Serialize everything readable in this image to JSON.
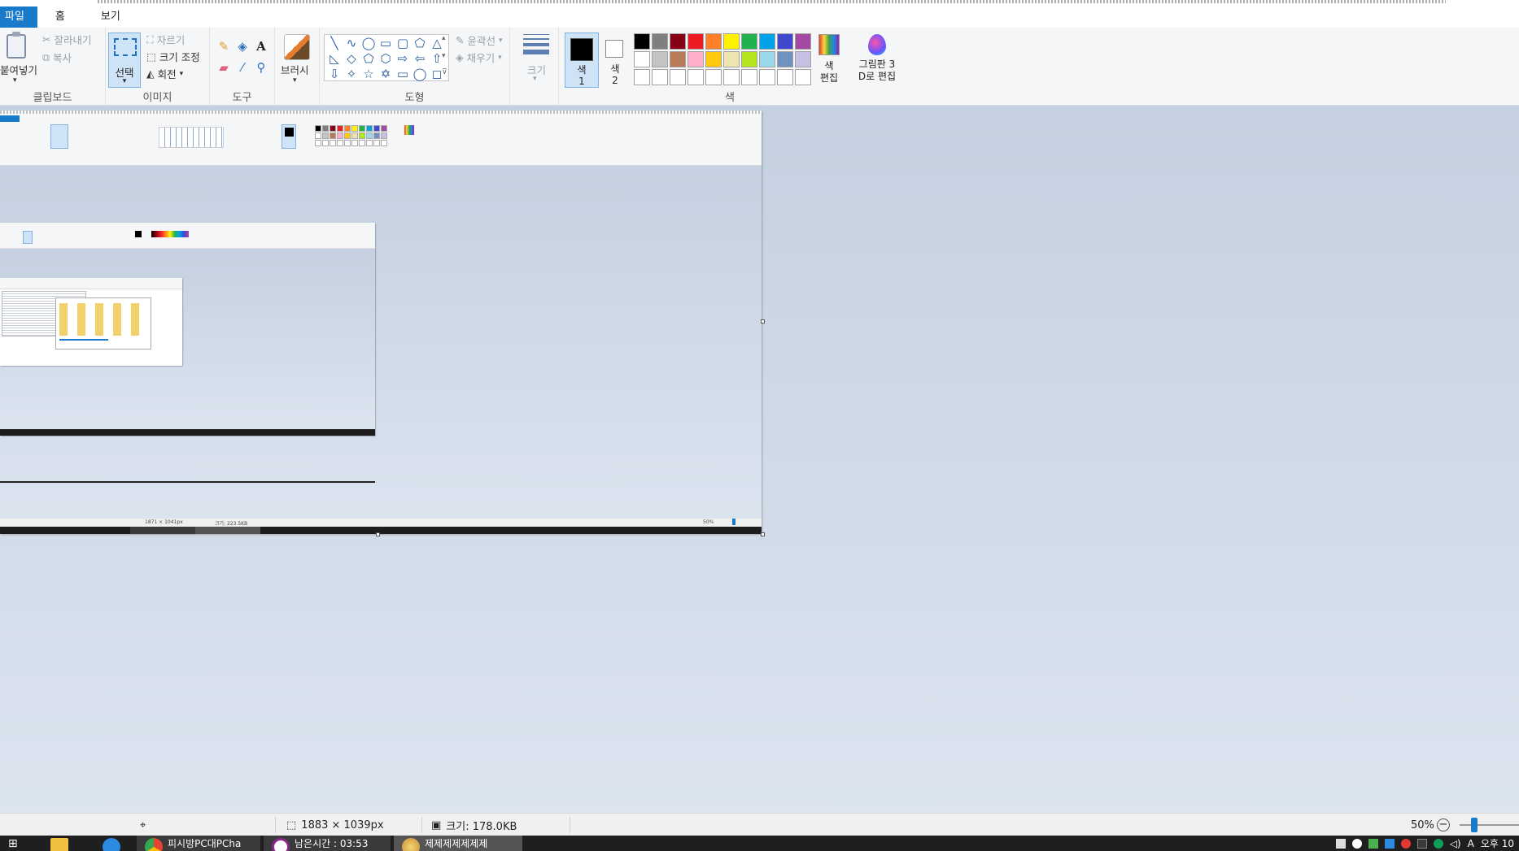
{
  "menu": {
    "file": "파일",
    "home": "홈",
    "view": "보기"
  },
  "clipboard": {
    "paste": "붙여넣기",
    "cut": "잘라내기",
    "copy": "복사",
    "label": "클립보드"
  },
  "image": {
    "select": "선택",
    "crop": "자르기",
    "resize": "크기 조정",
    "rotate": "회전",
    "label": "이미지"
  },
  "tools": {
    "label": "도구",
    "text_icon": "A"
  },
  "brushes": {
    "label": "브러시"
  },
  "shapes": {
    "label": "도형",
    "outline": "윤곽선",
    "fill": "채우기",
    "items": [
      "╲",
      "∿",
      "◯",
      "▭",
      "▢",
      "⬠",
      "△",
      "◺",
      "◇",
      "⬠",
      "⬡",
      "⇨",
      "⇦",
      "⇧",
      "⇩",
      "✧",
      "☆",
      "✡",
      "▭",
      "◯",
      "◻"
    ]
  },
  "size": {
    "label": "크기"
  },
  "colors": {
    "label": "색",
    "color1": "색\n1",
    "color2": "색\n2",
    "edit": "색\n편집",
    "paint3d": "그림판 3\nD로 편집",
    "palette": [
      "#000000",
      "#7f7f7f",
      "#880015",
      "#ed1c24",
      "#ff7f27",
      "#fff200",
      "#22b14c",
      "#00a2e8",
      "#3f48cc",
      "#a349a4",
      "#ffffff",
      "#c3c3c3",
      "#b97a57",
      "#ffaec9",
      "#ffc90e",
      "#efe4b0",
      "#b5e61d",
      "#99d9ea",
      "#7092be",
      "#c8bfe7",
      "#ffffff",
      "#ffffff",
      "#ffffff",
      "#ffffff",
      "#ffffff",
      "#ffffff",
      "#ffffff",
      "#ffffff",
      "#ffffff",
      "#ffffff"
    ]
  },
  "status": {
    "dimensions": "1883 × 1039px",
    "size": "크기: 178.0KB",
    "zoom": "50%"
  },
  "nested": {
    "dimensions": "1871 × 1041px",
    "size": "크기: 223.5KB",
    "zoom": "50%"
  },
  "taskbar": {
    "items": [
      {
        "label": "피시방PC대PCha"
      },
      {
        "label": "남은시간 : 03:53"
      },
      {
        "label": "제제제제제제제"
      }
    ],
    "clock": "오후 10"
  },
  "accent": "#1979ca"
}
